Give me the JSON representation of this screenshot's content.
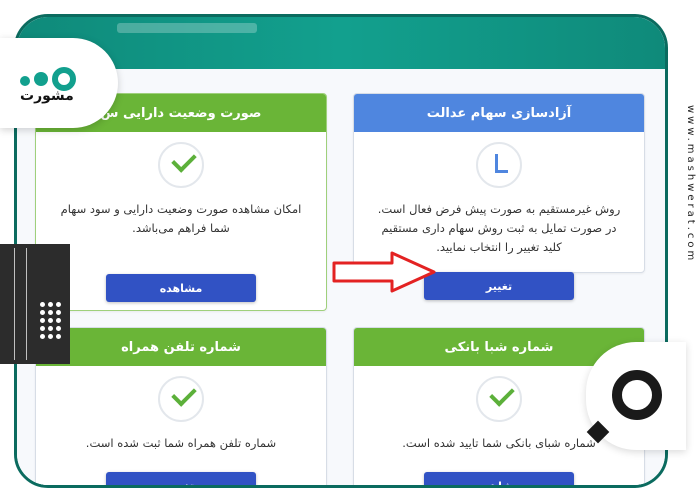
{
  "cards": [
    {
      "title": "آزادسازی سهام عدالت",
      "head_color": "#4f86df",
      "icon": "clock-icon",
      "description": "روش غیرمستقیم به صورت پیش فرض فعال است. در صورت تمایل به ثبت روش سهام داری مستقیم کلید تغییر را انتخاب نمایید.",
      "button": "تغییر"
    },
    {
      "title": "صورت وضعیت دارایی س",
      "head_color": "#6ab537",
      "icon": "check-icon",
      "description": "امکان مشاهده صورت وضعیت دارایی و سود سهام شما فراهم می‌باشد.",
      "button": "مشاهده"
    },
    {
      "title": "شماره شبا بانکی",
      "head_color": "#6ab537",
      "icon": "check-icon",
      "description": "شماره شبای بانکی شما تایید شده است.",
      "button": "مشاهده"
    },
    {
      "title": "شماره تلفن همراه",
      "head_color": "#6ab537",
      "icon": "check-icon",
      "description": "شماره تلفن همراه شما ثبت شده است.",
      "button": "تغییر"
    }
  ],
  "brand": {
    "logo_text": "مشورت",
    "site_vertical": "www.mashwerat.com",
    "accent": "#12a08e"
  },
  "annotation": {
    "arrow_color": "#e32222",
    "arrow_target": "تغییر"
  }
}
